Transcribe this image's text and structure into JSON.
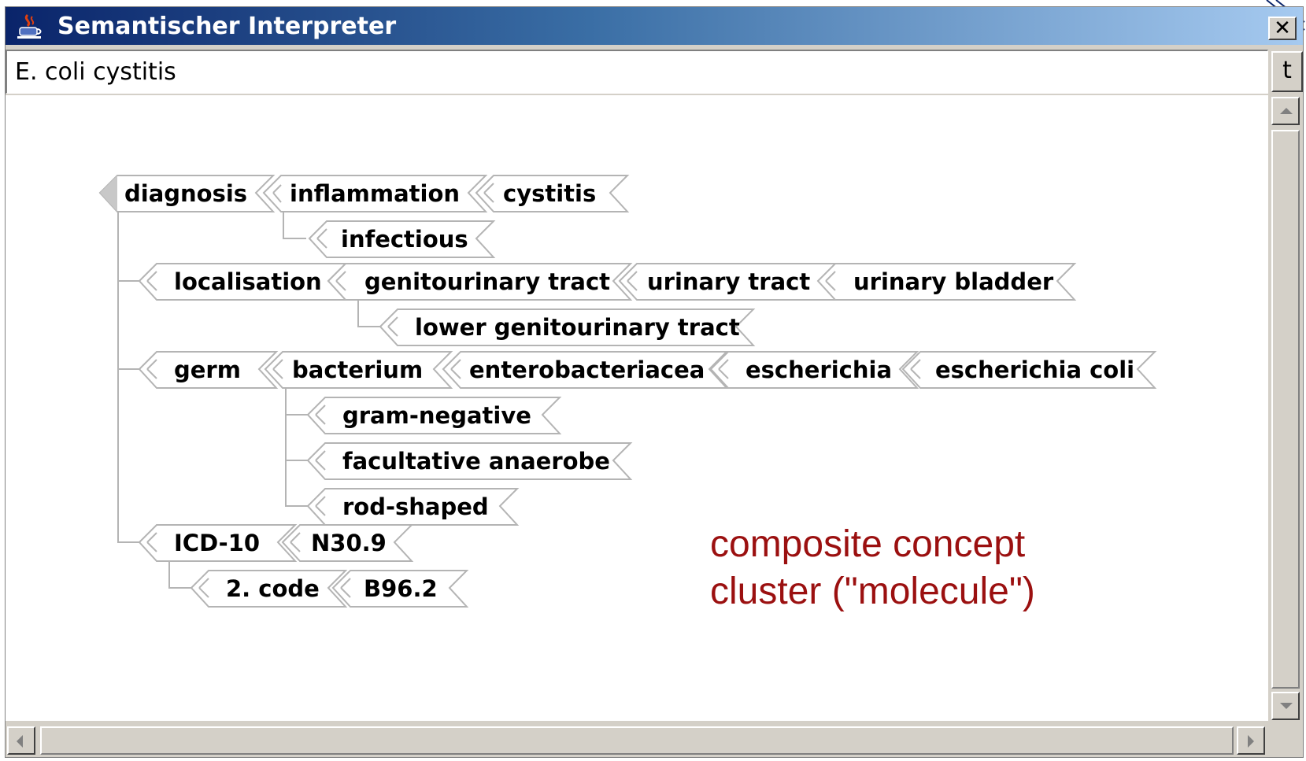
{
  "window": {
    "title": "Semantischer Interpreter",
    "close_label": "✕"
  },
  "query": {
    "value": "E. coli cystitis"
  },
  "side_button": {
    "label": "t"
  },
  "tree": {
    "diagnosis": {
      "label": "diagnosis",
      "children": [
        "inflammation",
        "cystitis"
      ],
      "sub": [
        "infectious"
      ]
    },
    "localisation": {
      "label": "localisation",
      "children": [
        "genitourinary tract",
        "urinary tract",
        "urinary bladder"
      ],
      "sub": [
        "lower genitourinary tract"
      ]
    },
    "germ": {
      "label": "germ",
      "children": [
        "bacterium",
        "enterobacteriacea",
        "escherichia",
        "escherichia coli"
      ],
      "sub": [
        "gram-negative",
        "facultative anaerobe",
        "rod-shaped"
      ]
    },
    "icd": {
      "label": "ICD-10",
      "children": [
        "N30.9"
      ],
      "sub_label": "2. code",
      "sub_value": "B96.2"
    }
  },
  "caption": {
    "line1": "composite concept",
    "line2": "cluster (\"molecule\")"
  },
  "colors": {
    "caption": "#9b1010",
    "title_bar_start": "#0a246a",
    "title_bar_end": "#a6caf0",
    "tag_stroke": "#b4b4b4"
  }
}
